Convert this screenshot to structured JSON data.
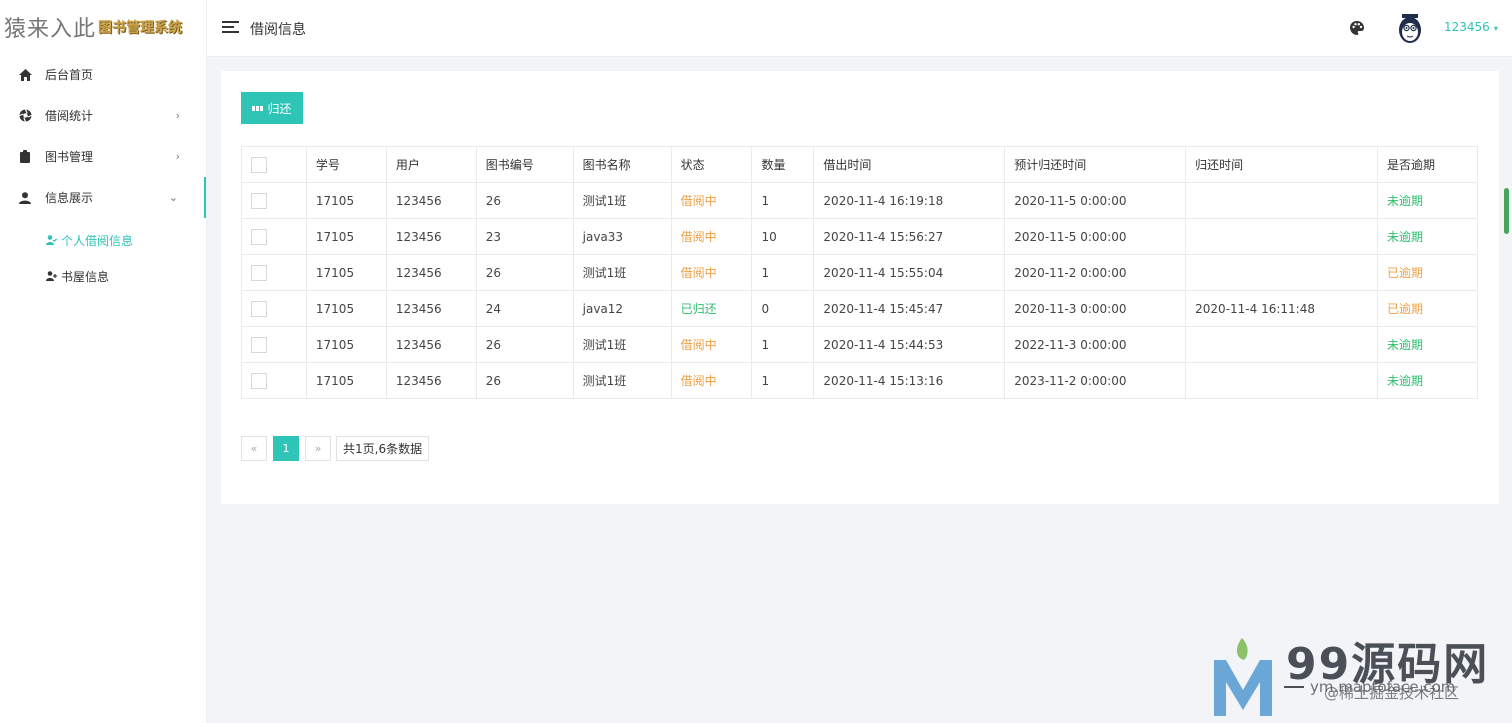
{
  "logo": {
    "main": "猿来入此",
    "sub": "图书管理系统"
  },
  "sidebar": {
    "items": [
      {
        "label": "后台首页",
        "icon": "home-icon"
      },
      {
        "label": "借阅统计",
        "icon": "aperture-icon"
      },
      {
        "label": "图书管理",
        "icon": "clipboard-icon"
      },
      {
        "label": "信息展示",
        "icon": "user-icon"
      }
    ],
    "submenu": [
      {
        "label": "个人借阅信息",
        "icon": "user-check-icon"
      },
      {
        "label": "书屋信息",
        "icon": "user-plus-icon"
      }
    ]
  },
  "header": {
    "title": "借阅信息",
    "user": "123456",
    "icons": [
      "menu-icon",
      "palette-icon",
      "avatar"
    ]
  },
  "toolbar": {
    "return_label": "归还"
  },
  "table": {
    "columns": [
      "学号",
      "用户",
      "图书编号",
      "图书名称",
      "状态",
      "数量",
      "借出时间",
      "预计归还时间",
      "归还时间",
      "是否逾期"
    ],
    "rows": [
      [
        "17105",
        "123456",
        "26",
        "测试1班",
        "借阅中",
        "1",
        "2020-11-4 16:19:18",
        "2020-11-5 0:00:00",
        "",
        "未逾期"
      ],
      [
        "17105",
        "123456",
        "23",
        "java33",
        "借阅中",
        "10",
        "2020-11-4 15:56:27",
        "2020-11-5 0:00:00",
        "",
        "未逾期"
      ],
      [
        "17105",
        "123456",
        "26",
        "测试1班",
        "借阅中",
        "1",
        "2020-11-4 15:55:04",
        "2020-11-2 0:00:00",
        "",
        "已逾期"
      ],
      [
        "17105",
        "123456",
        "24",
        "java12",
        "已归还",
        "0",
        "2020-11-4 15:45:47",
        "2020-11-3 0:00:00",
        "2020-11-4 16:11:48",
        "已逾期"
      ],
      [
        "17105",
        "123456",
        "26",
        "测试1班",
        "借阅中",
        "1",
        "2020-11-4 15:44:53",
        "2022-11-3 0:00:00",
        "",
        "未逾期"
      ],
      [
        "17105",
        "123456",
        "26",
        "测试1班",
        "借阅中",
        "1",
        "2020-11-4 15:13:16",
        "2023-11-2 0:00:00",
        "",
        "未逾期"
      ]
    ]
  },
  "pager": {
    "prev": "«",
    "current": "1",
    "next": "»",
    "info": "共1页,6条数据"
  },
  "colors": {
    "accent": "#2ec4b6",
    "borrowing": "#f0a043",
    "returned": "#2bbf6c",
    "not_overdue": "#2bbf6c",
    "overdue": "#f0a043"
  },
  "watermark": {
    "brand": "99源码网",
    "url": "ym.maptoface.com",
    "community": "@稀土掘金技术社区"
  }
}
